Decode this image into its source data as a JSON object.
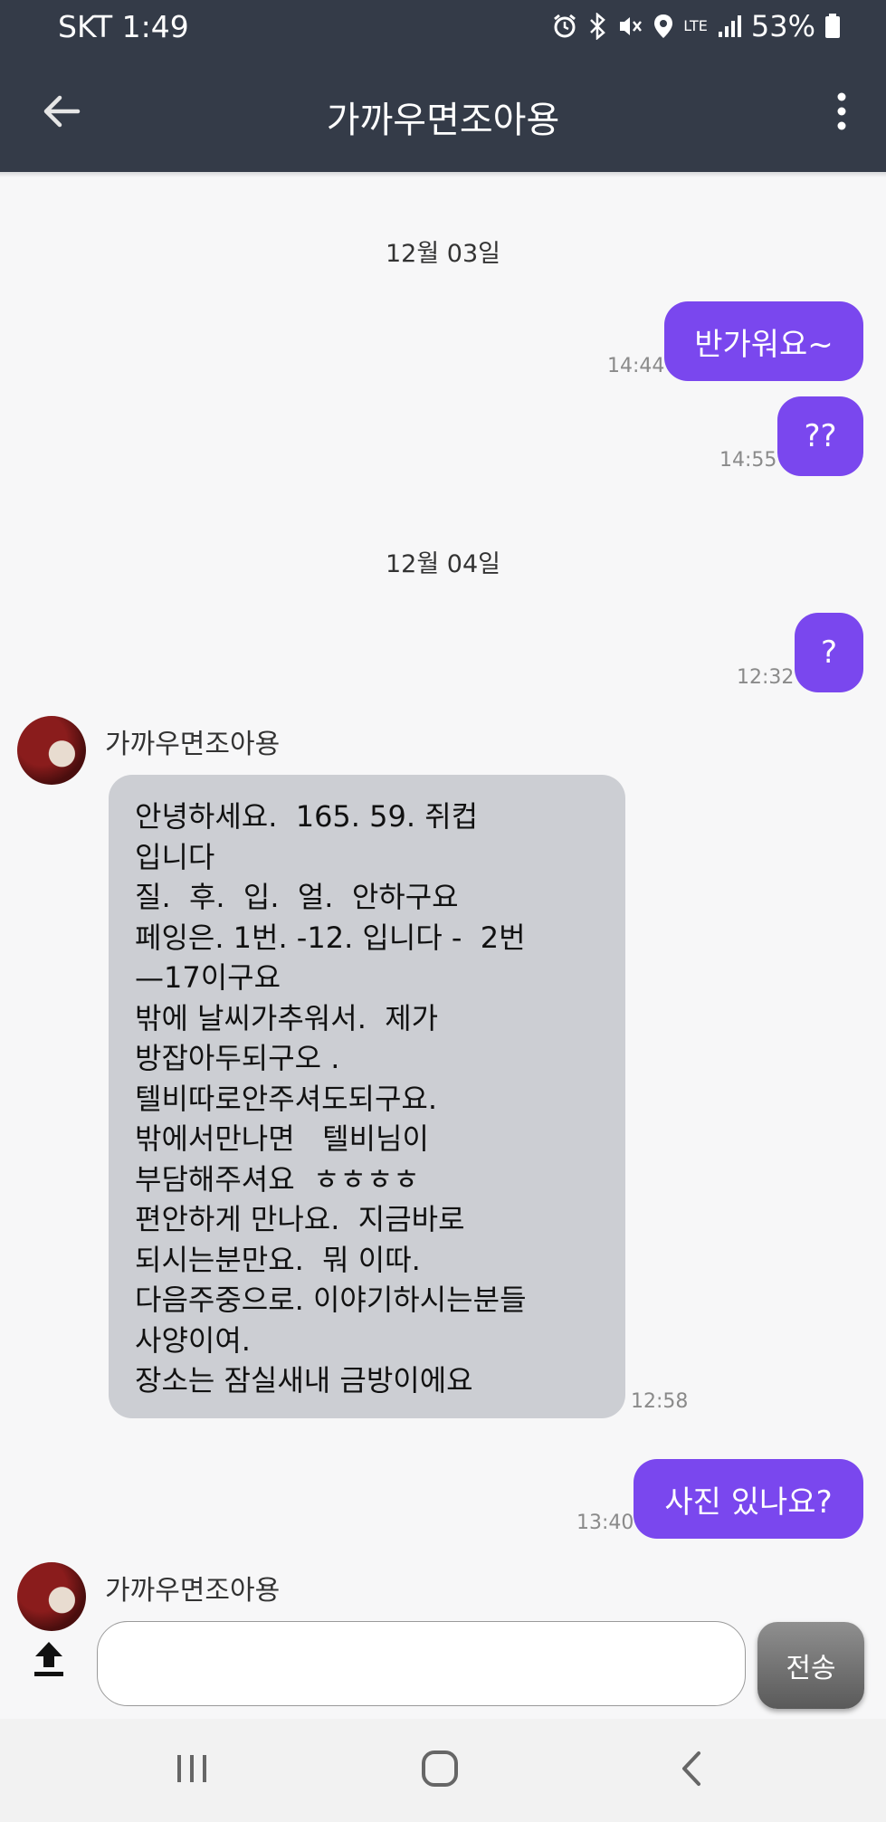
{
  "status_bar": {
    "carrier_time": "SKT 1:49",
    "network": "LTE",
    "battery": "53%",
    "icons": [
      "alarm-icon",
      "bluetooth-icon",
      "vibrate-mute-icon",
      "location-icon",
      "signal-icon",
      "battery-icon"
    ]
  },
  "app_bar": {
    "title": "가까우면조아용",
    "back_icon": "arrow-left-icon",
    "menu_icon": "more-vertical-icon"
  },
  "messages": {
    "date1": "12월 03일",
    "date2": "12월 04일",
    "out1": {
      "text": "반가워요~",
      "time": "14:44"
    },
    "out2": {
      "text": "??",
      "time": "14:55"
    },
    "out3": {
      "text": "?",
      "time": "12:32"
    },
    "in1": {
      "sender": "가까우면조아용",
      "time": "12:58",
      "lines": [
        "안녕하세요.  165. 59. 쥐컵",
        "입니다",
        "질.  후.  입.  얼.  안하구요",
        "페잉은. 1번. -12. 입니다 -  2번",
        "—17이구요",
        "밖에 날씨가추워서.  제가",
        "방잡아두되구오 .",
        "텔비따로안주셔도되구요.",
        "밖에서만나면   텔비님이",
        "부담해주셔요  ㅎㅎㅎㅎ",
        "편안하게 만나요.  지금바로",
        "되시는분만요.  뭐 이따.",
        "다음주중으로. 이야기하시는분들",
        "사양이여.",
        "장소는 잠실새내 금방이에요"
      ]
    },
    "out4": {
      "text": "사진 있나요?",
      "time": "13:40"
    },
    "in2": {
      "sender": "가까우면조아용"
    }
  },
  "composer": {
    "input_value": "",
    "send_label": "전송",
    "upload_icon": "upload-icon"
  },
  "nav_bar": {
    "icons": [
      "recent-apps-icon",
      "home-icon",
      "back-icon"
    ]
  },
  "colors": {
    "header": "#343b48",
    "outgoing_bubble": "#7a47ee",
    "incoming_bubble": "#ccced3",
    "background": "#f7f7f8"
  }
}
